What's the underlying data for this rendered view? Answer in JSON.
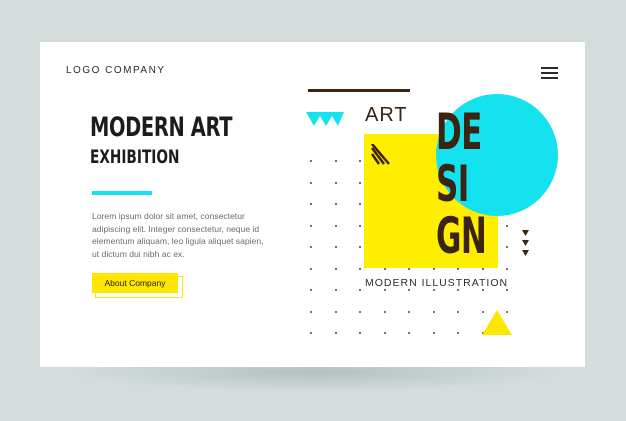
{
  "header": {
    "logo_text": "LOGO COMPANY",
    "menu_icon": "hamburger-menu-icon"
  },
  "hero": {
    "title": "MODERN ART",
    "subtitle": "EXHIBITION",
    "body": "Lorem ipsum dolor sit amet, consectetur adipiscing elit. Integer consectetur, neque id elementum aliquam, leo ligula aliquet sapien, ut dictum dui nibh ac ex.",
    "button_label": "About Company"
  },
  "artwork": {
    "art_label": "ART",
    "design_text": "DE\nSI\nGN",
    "caption": "MODERN ILLUSTRATION"
  },
  "colors": {
    "cyan": "#14e3ef",
    "yellow": "#ffe600",
    "dark_brown": "#3a2412",
    "background": "#d4dcdc"
  }
}
